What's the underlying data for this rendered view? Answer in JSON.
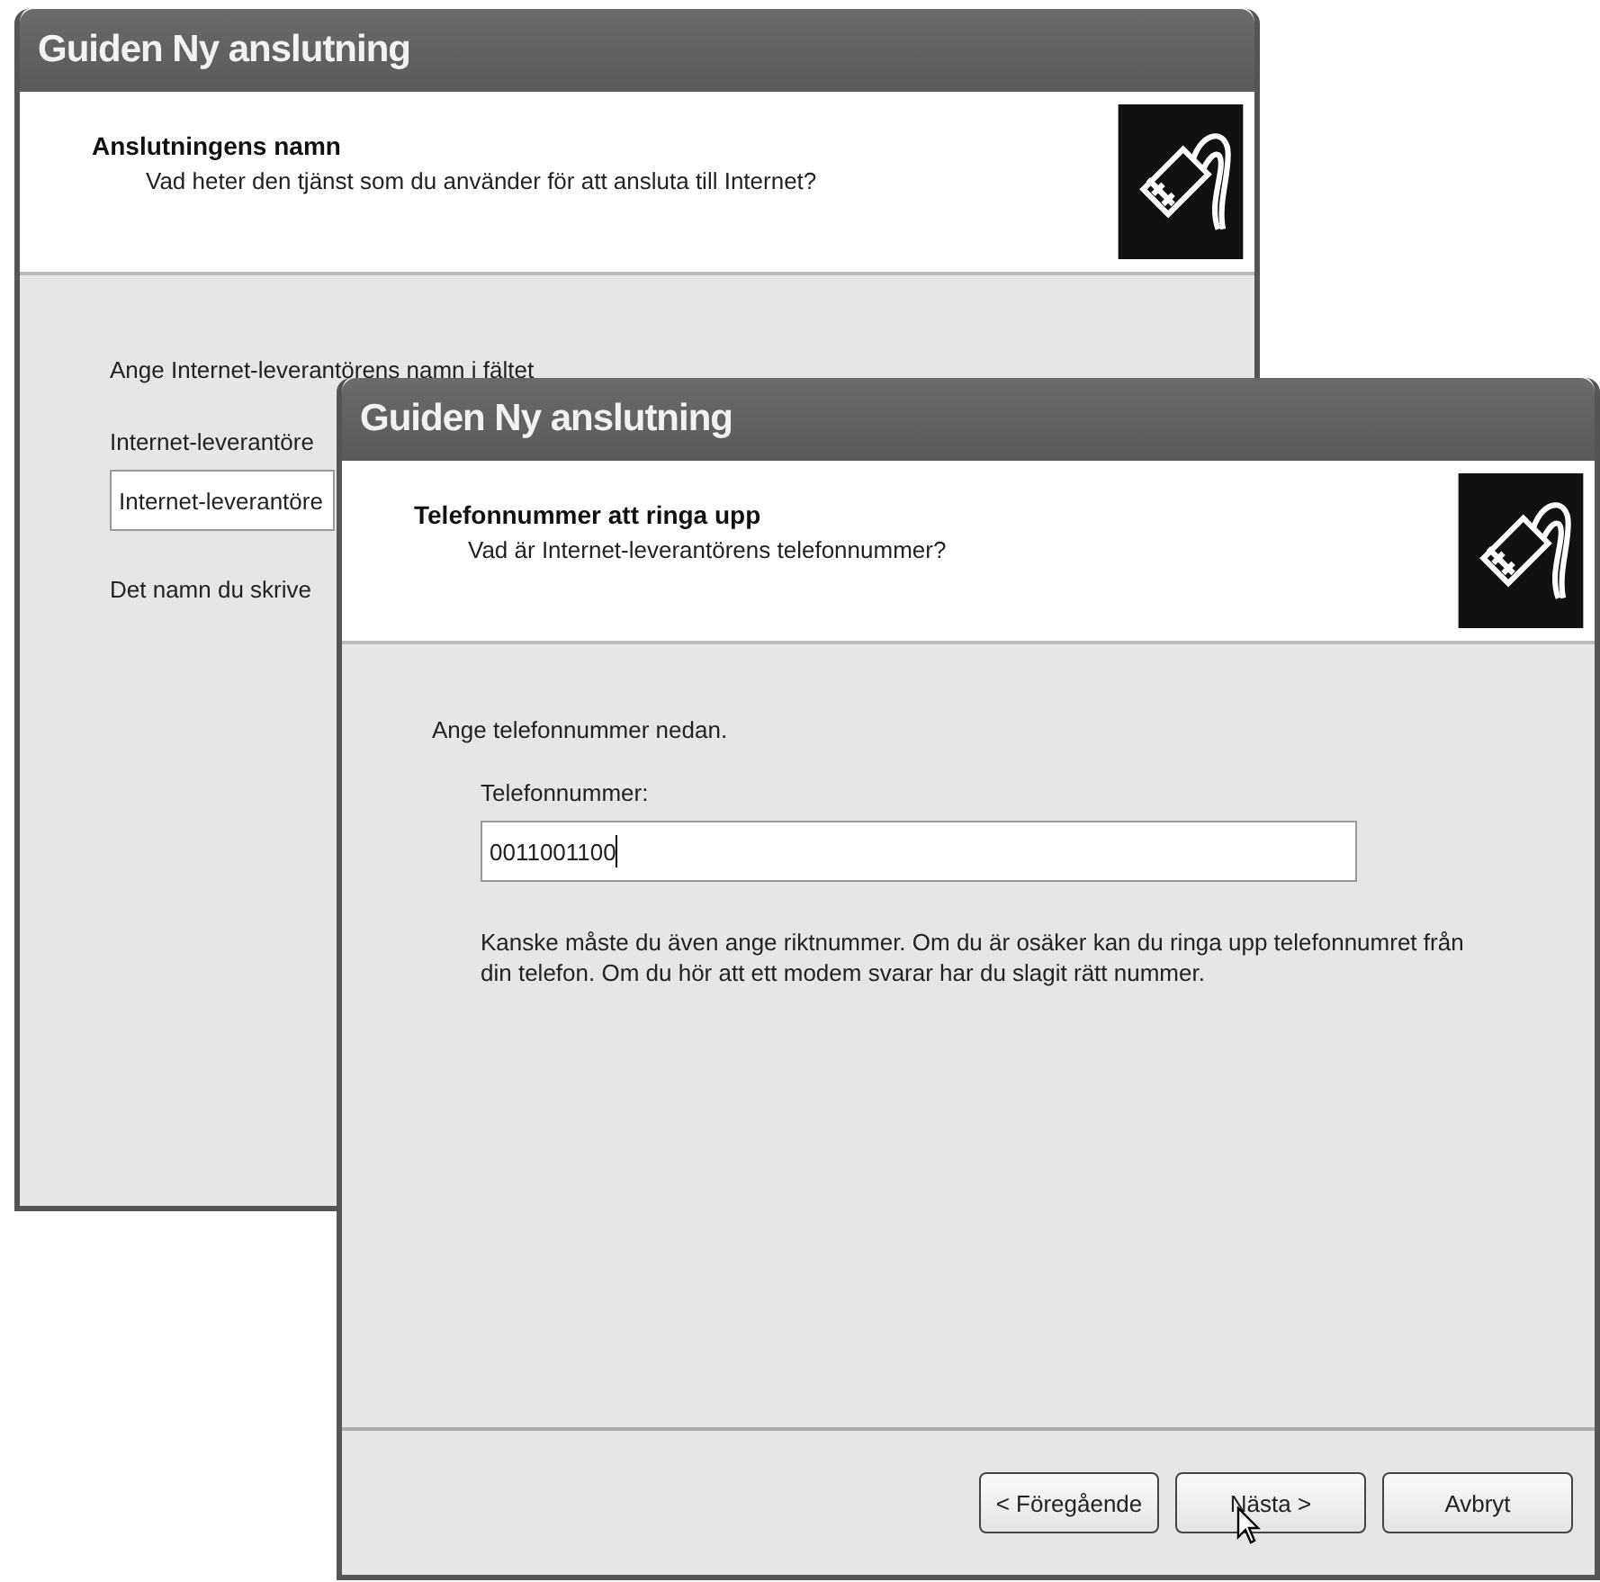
{
  "windows": [
    {
      "title": "Guiden Ny anslutning",
      "header_title": "Anslutningens namn",
      "header_subtitle": "Vad heter den tjänst som du använder för att ansluta till Internet?",
      "intro": "Ange Internet-leverantörens namn i fältet",
      "field_label": "Internet-leverantöre",
      "field_value": "Internet-leverantöre",
      "note": "Det namn du skrive"
    },
    {
      "title": "Guiden Ny anslutning",
      "header_title": "Telefonnummer att ringa upp",
      "header_subtitle": "Vad är Internet-leverantörens telefonnummer?",
      "intro": "Ange telefonnummer nedan.",
      "field_label": "Telefonnummer:",
      "field_value": "0011001100",
      "note": "Kanske måste du även ange riktnummer. Om du är osäker kan du ringa upp telefonnumret från din telefon. Om du hör att ett modem svarar har du slagit rätt nummer.",
      "buttons": [
        "< Föregående",
        "Nästa >",
        "Avbryt"
      ]
    }
  ]
}
